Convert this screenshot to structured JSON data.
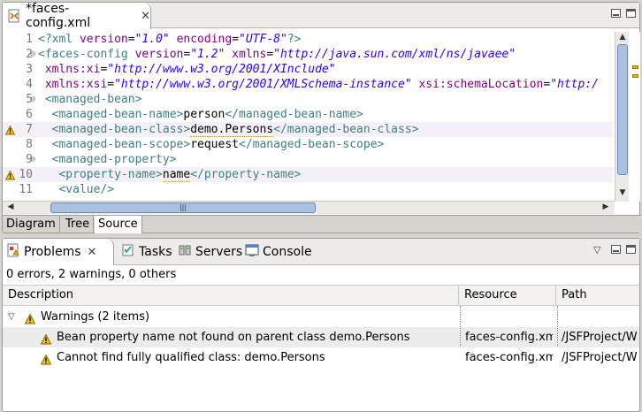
{
  "editor": {
    "tab_label": "*faces-config.xml",
    "lines": [
      {
        "num": "1",
        "parts": [
          [
            "tag",
            "<?xml "
          ],
          [
            "attr",
            "version"
          ],
          [
            "txt",
            "="
          ],
          [
            "str",
            "\"1.0\""
          ],
          [
            "txt",
            " "
          ],
          [
            "attr",
            "encoding"
          ],
          [
            "txt",
            "="
          ],
          [
            "str",
            "\"UTF-8\""
          ],
          [
            "tag",
            "?>"
          ]
        ]
      },
      {
        "num": "2",
        "fold": true,
        "parts": [
          [
            "tag",
            "<faces-config "
          ],
          [
            "attr",
            "version"
          ],
          [
            "txt",
            "="
          ],
          [
            "str",
            "\"1.2\""
          ],
          [
            "txt",
            " "
          ],
          [
            "attr",
            "xmlns"
          ],
          [
            "txt",
            "="
          ],
          [
            "str",
            "\"http://java.sun.com/xml/ns/javaee\""
          ]
        ]
      },
      {
        "num": "3",
        "parts": [
          [
            "txt",
            " "
          ],
          [
            "attr",
            "xmlns:xi"
          ],
          [
            "txt",
            "="
          ],
          [
            "str",
            "\"http://www.w3.org/2001/XInclude\""
          ]
        ]
      },
      {
        "num": "4",
        "parts": [
          [
            "txt",
            " "
          ],
          [
            "attr",
            "xmlns:xsi"
          ],
          [
            "txt",
            "="
          ],
          [
            "str",
            "\"http://www.w3.org/2001/XMLSchema-instance\""
          ],
          [
            "txt",
            " "
          ],
          [
            "attr",
            "xsi:schemaLocation"
          ],
          [
            "txt",
            "="
          ],
          [
            "str",
            "\"http:/"
          ]
        ]
      },
      {
        "num": "5",
        "fold": true,
        "parts": [
          [
            "txt",
            " "
          ],
          [
            "tag",
            "<managed-bean>"
          ]
        ]
      },
      {
        "num": "6",
        "parts": [
          [
            "txt",
            "  "
          ],
          [
            "tag",
            "<managed-bean-name>"
          ],
          [
            "txt",
            "person"
          ],
          [
            "tag",
            "</managed-bean-name>"
          ]
        ]
      },
      {
        "num": "7",
        "warn": true,
        "parts": [
          [
            "txt",
            "  "
          ],
          [
            "tag",
            "<managed-bean-class>"
          ],
          [
            "squig",
            "demo.Persons"
          ],
          [
            "tag",
            "</managed-bean-class>"
          ]
        ]
      },
      {
        "num": "8",
        "parts": [
          [
            "txt",
            "  "
          ],
          [
            "tag",
            "<managed-bean-scope>"
          ],
          [
            "txt",
            "request"
          ],
          [
            "tag",
            "</managed-bean-scope>"
          ]
        ]
      },
      {
        "num": "9",
        "fold": true,
        "parts": [
          [
            "txt",
            "  "
          ],
          [
            "tag",
            "<managed-property>"
          ]
        ]
      },
      {
        "num": "10",
        "warn": true,
        "parts": [
          [
            "txt",
            "   "
          ],
          [
            "tag",
            "<property-name>"
          ],
          [
            "squig",
            "name"
          ],
          [
            "tag",
            "</property-name>"
          ]
        ]
      },
      {
        "num": "11",
        "parts": [
          [
            "txt",
            "   "
          ],
          [
            "tag",
            "<value/>"
          ]
        ]
      }
    ],
    "bottom_tabs": [
      "Diagram",
      "Tree",
      "Source"
    ],
    "active_bottom_tab": "Source"
  },
  "problems_view": {
    "tabs": [
      "Problems",
      "Tasks",
      "Servers",
      "Console"
    ],
    "active_tab": "Problems",
    "summary": "0 errors, 2 warnings, 0 others",
    "columns": [
      "Description",
      "Resource",
      "Path"
    ],
    "group_label": "Warnings (2 items)",
    "rows": [
      {
        "description": "Bean property name not found on parent class demo.Persons",
        "resource": "faces-config.xm",
        "path": "/JSFProject/W"
      },
      {
        "description": "Cannot find fully qualified class: demo.Persons",
        "resource": "faces-config.xm",
        "path": "/JSFProject/W"
      }
    ]
  },
  "colors": {
    "tag": "#3f7f7f",
    "attribute": "#7f007f",
    "string": "#2a00ff",
    "warning": "#e8b400"
  },
  "icons": [
    "xml-file-icon",
    "close-icon",
    "minimize-icon",
    "maximize-icon",
    "warning-icon",
    "fold-icon",
    "problems-icon",
    "tasks-icon",
    "servers-icon",
    "console-icon",
    "view-menu-icon",
    "tree-collapse-icon"
  ]
}
